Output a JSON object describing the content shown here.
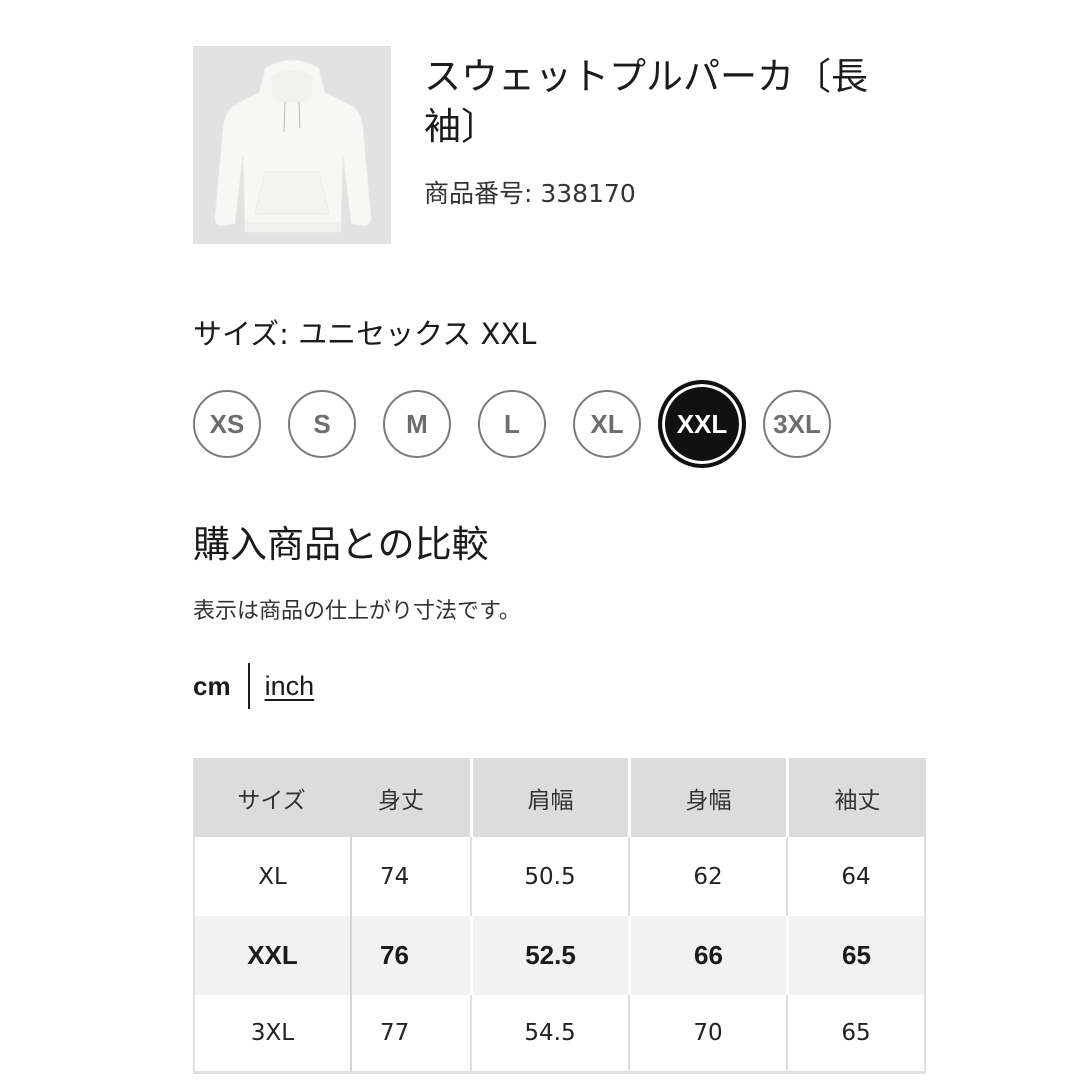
{
  "product": {
    "image_alt": "white-hoodie-image",
    "title": "スウェットプルパーカ(長袖)",
    "title_line1": "スウェットプルパーカ〔長",
    "title_line2": "袖〕",
    "product_id_label": "商品番号: 338170"
  },
  "size_selector": {
    "label": "サイズ: ユニセックス XXL",
    "options": [
      {
        "label": "XS",
        "selected": false
      },
      {
        "label": "S",
        "selected": false
      },
      {
        "label": "M",
        "selected": false
      },
      {
        "label": "L",
        "selected": false
      },
      {
        "label": "XL",
        "selected": false
      },
      {
        "label": "XXL",
        "selected": true
      },
      {
        "label": "3XL",
        "selected": false
      }
    ]
  },
  "comparison": {
    "title": "購入商品との比較",
    "note": "表示は商品の仕上がり寸法です。",
    "units": {
      "cm_label": "cm",
      "inch_label": "inch",
      "active": "cm"
    },
    "table": {
      "headers": [
        "サイズ",
        "身丈",
        "肩幅",
        "身幅",
        "袖丈"
      ],
      "rows": [
        {
          "size": "XL",
          "values": [
            "74",
            "50.5",
            "62",
            "64"
          ],
          "highlight": false
        },
        {
          "size": "XXL",
          "values": [
            "76",
            "52.5",
            "66",
            "65"
          ],
          "highlight": true
        },
        {
          "size": "3XL",
          "values": [
            "77",
            "54.5",
            "70",
            "65"
          ],
          "highlight": false
        }
      ]
    }
  },
  "colors": {
    "selected_size_bg": "#111111",
    "unselected_border": "#7a7a7a",
    "table_header_bg": "#dcdcdc",
    "highlight_row_bg": "#f2f2f2",
    "image_bg": "#e2e2e2"
  }
}
